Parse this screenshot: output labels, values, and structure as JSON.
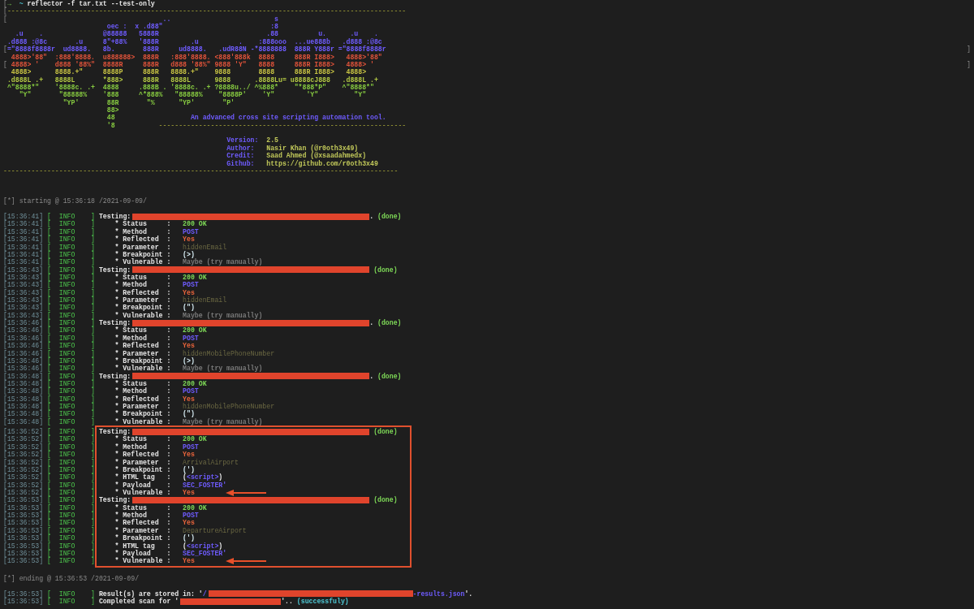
{
  "prompt": {
    "segments": [
      {
        "kind": "bracket",
        "text": "["
      },
      {
        "kind": "prompt",
        "text": "→"
      },
      {
        "kind": "dir",
        "text": "  ~"
      },
      {
        "kind": "command",
        "text": " reflector -f tar.txt --test-only"
      }
    ]
  },
  "banner": {
    "top_rule": {
      "segments": [
        {
          "kind": "bracket",
          "text": "["
        },
        {
          "kind": "rule",
          "text": "----------------------------------------------------------------------------------------------------"
        }
      ]
    },
    "art": [
      {
        "segments": [
          {
            "kind": "bracket",
            "text": "["
          },
          {
            "kind": "crest",
            "text": "                                       ..                          s"
          }
        ]
      },
      {
        "segments": [
          {
            "kind": "crest",
            "text": "                          oec :  x .d88\"                           :8"
          }
        ]
      },
      {
        "segments": [
          {
            "kind": "crest",
            "text": "   .u    .               @88888   5888R                           .88          u.      .u    ."
          }
        ]
      },
      {
        "segments": [
          {
            "kind": "crest",
            "text": " .d888 :@8c       .u     8\"+88%   '888R        .u          .    :888ooo  ...ue888b   .d888 :@8c"
          }
        ]
      },
      {
        "segments": [
          {
            "kind": "bracket",
            "text": "["
          },
          {
            "kind": "crest",
            "text": "=\"8888f8888r  ud8888.   8b.       888R     ud8888.   .udR88N -*8888888  888R Y888r =\"8888f8888r"
          }
        ],
        "edge": "]"
      },
      {
        "segments": [
          {
            "kind": "ember",
            "text": "  4888>'88\"  :888'8888.  u888888>  888R   :888'8888. <888'888k  8888     888R I888>   4888>'88\""
          }
        ]
      },
      {
        "segments": [
          {
            "kind": "bracket",
            "text": "["
          },
          {
            "kind": "ember",
            "text": " 4888> '    d888 '88%\"  8888R     888R   d888 '88%\" 9888 'Y\"   8888     888R I888>   4888> '"
          }
        ],
        "edge": "]"
      },
      {
        "segments": [
          {
            "kind": "straw",
            "text": "  4888>      8888.+\"     8888P     888R   8888.+\"    9888       8888     888R I888>   4888>"
          }
        ]
      },
      {
        "segments": [
          {
            "kind": "lime",
            "text": " .d888L .+   8888L       *888>     888R   8888L      9888      .8888Lu= u8888cJ888   .d888L .+"
          }
        ]
      },
      {
        "segments": [
          {
            "kind": "leaf",
            "text": " ^\"8888*\"    '8888c. .+  4888     .888B . '8888c. .+ ?8888u../ ^%888*    \"*888*P\"    ^\"8888*\""
          }
        ]
      },
      {
        "segments": [
          {
            "kind": "leaf",
            "text": "    \"Y\"       \"88888%    '888     ^*888%   \"88888%    \"8888P'    'Y\"        'Y\"         \"Y\""
          }
        ]
      },
      {
        "segments": [
          {
            "kind": "leaf",
            "text": "               \"YP'       88R       \"%      \"YP'       \"P'"
          }
        ]
      },
      {
        "segments": [
          {
            "kind": "leaf",
            "text": "                          88>"
          }
        ]
      },
      {
        "segments": [
          {
            "kind": "leaf",
            "text": "                          48"
          },
          {
            "kind": "tagline",
            "text": "                   An advanced cross site scripting automation tool."
          }
        ]
      },
      {
        "segments": [
          {
            "kind": "leaf",
            "text": "                          '8"
          },
          {
            "kind": "rule",
            "text": "           --------------------------------------------------------------"
          }
        ]
      }
    ],
    "credits": [
      {
        "segments": [
          {
            "kind": "label",
            "text": "                                                        Version:"
          },
          {
            "kind": "value",
            "text": "  2.5"
          }
        ]
      },
      {
        "segments": [
          {
            "kind": "label",
            "text": "                                                        Author:"
          },
          {
            "kind": "value",
            "text": "   Nasir Khan (@r0oth3x49)"
          }
        ]
      },
      {
        "segments": [
          {
            "kind": "label",
            "text": "                                                        Credit:"
          },
          {
            "kind": "value",
            "text": "   Saad Ahmed (@xsaadahmedx)"
          }
        ]
      },
      {
        "segments": [
          {
            "kind": "label",
            "text": "                                                        Github:"
          },
          {
            "kind": "value",
            "text": "   https://github.com/r0oth3x49"
          }
        ]
      }
    ],
    "bottom_rule": {
      "segments": [
        {
          "kind": "rule",
          "text": "---------------------------------------------------------------------------------------------------"
        }
      ]
    }
  },
  "log": {
    "start": "[*] starting @ 15:36:18 /2021-09-09/",
    "tests": [
      {
        "time": "[15:36:41]",
        "level": "[  INFO    ]",
        "label": "Testing:",
        "highlighted": false,
        "tail": [
          {
            "kind": "plain",
            "text": "."
          },
          {
            "kind": "done",
            "text": " (done)"
          }
        ],
        "fields": [
          {
            "time": "[15:36:41]",
            "level": "[  INFO    ]",
            "label": "* Status     :",
            "arrow": false,
            "parts": [
              {
                "kind": "ok",
                "text": "200 OK"
              }
            ]
          },
          {
            "time": "[15:36:41]",
            "level": "[  INFO    ]",
            "label": "* Method     :",
            "arrow": false,
            "parts": [
              {
                "kind": "method",
                "text": "POST"
              }
            ]
          },
          {
            "time": "[15:36:41]",
            "level": "[  INFO    ]",
            "label": "* Reflected  :",
            "arrow": false,
            "parts": [
              {
                "kind": "yes",
                "text": "Yes"
              }
            ]
          },
          {
            "time": "[15:36:41]",
            "level": "[  INFO    ]",
            "label": "* Parameter  :",
            "arrow": false,
            "parts": [
              {
                "kind": "param",
                "text": "hiddenEmail"
              }
            ]
          },
          {
            "time": "[15:36:41]",
            "level": "[  INFO    ]",
            "label": "* Breakpoint :",
            "arrow": false,
            "parts": [
              {
                "kind": "breakpoint",
                "text": "(>)"
              }
            ]
          },
          {
            "time": "[15:36:41]",
            "level": "[  INFO    ]",
            "label": "* Vulnerable :",
            "arrow": false,
            "parts": [
              {
                "kind": "maybe",
                "text": "Maybe (try manually)"
              }
            ]
          }
        ]
      },
      {
        "time": "[15:36:43]",
        "level": "[  INFO    ]",
        "label": "Testing:",
        "highlighted": false,
        "tail": [
          {
            "kind": "done",
            "text": " (done)"
          }
        ],
        "fields": [
          {
            "time": "[15:36:43]",
            "level": "[  INFO    ]",
            "label": "* Status     :",
            "arrow": false,
            "parts": [
              {
                "kind": "ok",
                "text": "200 OK"
              }
            ]
          },
          {
            "time": "[15:36:43]",
            "level": "[  INFO    ]",
            "label": "* Method     :",
            "arrow": false,
            "parts": [
              {
                "kind": "method",
                "text": "POST"
              }
            ]
          },
          {
            "time": "[15:36:43]",
            "level": "[  INFO    ]",
            "label": "* Reflected  :",
            "arrow": false,
            "parts": [
              {
                "kind": "yes",
                "text": "Yes"
              }
            ]
          },
          {
            "time": "[15:36:43]",
            "level": "[  INFO    ]",
            "label": "* Parameter  :",
            "arrow": false,
            "parts": [
              {
                "kind": "param",
                "text": "hiddenEmail"
              }
            ]
          },
          {
            "time": "[15:36:43]",
            "level": "[  INFO    ]",
            "label": "* Breakpoint :",
            "arrow": false,
            "parts": [
              {
                "kind": "breakpoint",
                "text": "(\")"
              }
            ]
          },
          {
            "time": "[15:36:43]",
            "level": "[  INFO    ]",
            "label": "* Vulnerable :",
            "arrow": false,
            "parts": [
              {
                "kind": "maybe",
                "text": "Maybe (try manually)"
              }
            ]
          }
        ]
      },
      {
        "time": "[15:36:46]",
        "level": "[  INFO    ]",
        "label": "Testing:",
        "highlighted": false,
        "tail": [
          {
            "kind": "plain",
            "text": "."
          },
          {
            "kind": "done",
            "text": " (done)"
          }
        ],
        "fields": [
          {
            "time": "[15:36:46]",
            "level": "[  INFO    ]",
            "label": "* Status     :",
            "arrow": false,
            "parts": [
              {
                "kind": "ok",
                "text": "200 OK"
              }
            ]
          },
          {
            "time": "[15:36:46]",
            "level": "[  INFO    ]",
            "label": "* Method     :",
            "arrow": false,
            "parts": [
              {
                "kind": "method",
                "text": "POST"
              }
            ]
          },
          {
            "time": "[15:36:46]",
            "level": "[  INFO    ]",
            "label": "* Reflected  :",
            "arrow": false,
            "parts": [
              {
                "kind": "yes",
                "text": "Yes"
              }
            ]
          },
          {
            "time": "[15:36:46]",
            "level": "[  INFO    ]",
            "label": "* Parameter  :",
            "arrow": false,
            "parts": [
              {
                "kind": "param",
                "text": "hiddenMobilePhoneNumber"
              }
            ]
          },
          {
            "time": "[15:36:46]",
            "level": "[  INFO    ]",
            "label": "* Breakpoint :",
            "arrow": false,
            "parts": [
              {
                "kind": "breakpoint",
                "text": "(>)"
              }
            ]
          },
          {
            "time": "[15:36:46]",
            "level": "[  INFO    ]",
            "label": "* Vulnerable :",
            "arrow": false,
            "parts": [
              {
                "kind": "maybe",
                "text": "Maybe (try manually)"
              }
            ]
          }
        ]
      },
      {
        "time": "[15:36:48]",
        "level": "[  INFO    ]",
        "label": "Testing:",
        "highlighted": false,
        "tail": [
          {
            "kind": "plain",
            "text": "."
          },
          {
            "kind": "done",
            "text": " (done)"
          }
        ],
        "fields": [
          {
            "time": "[15:36:48]",
            "level": "[  INFO    ]",
            "label": "* Status     :",
            "arrow": false,
            "parts": [
              {
                "kind": "ok",
                "text": "200 OK"
              }
            ]
          },
          {
            "time": "[15:36:48]",
            "level": "[  INFO    ]",
            "label": "* Method     :",
            "arrow": false,
            "parts": [
              {
                "kind": "method",
                "text": "POST"
              }
            ]
          },
          {
            "time": "[15:36:48]",
            "level": "[  INFO    ]",
            "label": "* Reflected  :",
            "arrow": false,
            "parts": [
              {
                "kind": "yes",
                "text": "Yes"
              }
            ]
          },
          {
            "time": "[15:36:48]",
            "level": "[  INFO    ]",
            "label": "* Parameter  :",
            "arrow": false,
            "parts": [
              {
                "kind": "param",
                "text": "hiddenMobilePhoneNumber"
              }
            ]
          },
          {
            "time": "[15:36:48]",
            "level": "[  INFO    ]",
            "label": "* Breakpoint :",
            "arrow": false,
            "parts": [
              {
                "kind": "breakpoint",
                "text": "(\")"
              }
            ]
          },
          {
            "time": "[15:36:48]",
            "level": "[  INFO    ]",
            "label": "* Vulnerable :",
            "arrow": false,
            "parts": [
              {
                "kind": "maybe",
                "text": "Maybe (try manually)"
              }
            ]
          }
        ]
      },
      {
        "time": "[15:36:52]",
        "level": "[  INFO    ]",
        "label": "Testing:",
        "highlighted": true,
        "tail": [
          {
            "kind": "done",
            "text": " (done)"
          }
        ],
        "fields": [
          {
            "time": "[15:36:52]",
            "level": "[  INFO    ]",
            "label": "* Status     :",
            "arrow": false,
            "parts": [
              {
                "kind": "ok",
                "text": "200 OK"
              }
            ]
          },
          {
            "time": "[15:36:52]",
            "level": "[  INFO    ]",
            "label": "* Method     :",
            "arrow": false,
            "parts": [
              {
                "kind": "method",
                "text": "POST"
              }
            ]
          },
          {
            "time": "[15:36:52]",
            "level": "[  INFO    ]",
            "label": "* Reflected  :",
            "arrow": false,
            "parts": [
              {
                "kind": "yes",
                "text": "Yes"
              }
            ]
          },
          {
            "time": "[15:36:52]",
            "level": "[  INFO    ]",
            "label": "* Parameter  :",
            "arrow": false,
            "parts": [
              {
                "kind": "param",
                "text": "ArrivalAirport"
              }
            ]
          },
          {
            "time": "[15:36:52]",
            "level": "[  INFO    ]",
            "label": "* Breakpoint :",
            "arrow": false,
            "parts": [
              {
                "kind": "breakpoint",
                "text": "(')"
              }
            ]
          },
          {
            "time": "[15:36:52]",
            "level": "[  INFO    ]",
            "label": "* HTML tag   :",
            "arrow": false,
            "parts": [
              {
                "kind": "plain",
                "text": "("
              },
              {
                "kind": "tag",
                "text": "<script>"
              },
              {
                "kind": "plain",
                "text": ")"
              }
            ]
          },
          {
            "time": "[15:36:52]",
            "level": "[  INFO    ]",
            "label": "* Payload    :",
            "arrow": false,
            "parts": [
              {
                "kind": "payload",
                "text": "SEC_FOSTER'"
              }
            ]
          },
          {
            "time": "[15:36:52]",
            "level": "[  INFO    ]",
            "label": "* Vulnerable :",
            "arrow": true,
            "parts": [
              {
                "kind": "yes",
                "text": "Yes"
              }
            ]
          }
        ]
      },
      {
        "time": "[15:36:53]",
        "level": "[  INFO    ]",
        "label": "Testing:",
        "highlighted": true,
        "tail": [
          {
            "kind": "done",
            "text": " (done)"
          }
        ],
        "fields": [
          {
            "time": "[15:36:53]",
            "level": "[  INFO    ]",
            "label": "* Status     :",
            "arrow": false,
            "parts": [
              {
                "kind": "ok",
                "text": "200 OK"
              }
            ]
          },
          {
            "time": "[15:36:53]",
            "level": "[  INFO    ]",
            "label": "* Method     :",
            "arrow": false,
            "parts": [
              {
                "kind": "method",
                "text": "POST"
              }
            ]
          },
          {
            "time": "[15:36:53]",
            "level": "[  INFO    ]",
            "label": "* Reflected  :",
            "arrow": false,
            "parts": [
              {
                "kind": "yes",
                "text": "Yes"
              }
            ]
          },
          {
            "time": "[15:36:53]",
            "level": "[  INFO    ]",
            "label": "* Parameter  :",
            "arrow": false,
            "parts": [
              {
                "kind": "param",
                "text": "DepartureAirport"
              }
            ]
          },
          {
            "time": "[15:36:53]",
            "level": "[  INFO    ]",
            "label": "* Breakpoint :",
            "arrow": false,
            "parts": [
              {
                "kind": "breakpoint",
                "text": "(')"
              }
            ]
          },
          {
            "time": "[15:36:53]",
            "level": "[  INFO    ]",
            "label": "* HTML tag   :",
            "arrow": false,
            "parts": [
              {
                "kind": "plain",
                "text": "("
              },
              {
                "kind": "tag",
                "text": "<script>"
              },
              {
                "kind": "plain",
                "text": ")"
              }
            ]
          },
          {
            "time": "[15:36:53]",
            "level": "[  INFO    ]",
            "label": "* Payload    :",
            "arrow": false,
            "parts": [
              {
                "kind": "payload",
                "text": "SEC_FOSTER'"
              }
            ]
          },
          {
            "time": "[15:36:53]",
            "level": "[  INFO    ]",
            "label": "* Vulnerable :",
            "arrow": true,
            "parts": [
              {
                "kind": "yes",
                "text": "Yes"
              }
            ]
          }
        ]
      }
    ],
    "end": "[*] ending @ 15:36:53 /2021-09-09/",
    "results": [
      {
        "time": "[15:36:53]",
        "level": "[  INFO    ]",
        "kind": "stored",
        "parts": [
          {
            "kind": "plain",
            "text": "Result(s) are stored in: '"
          },
          {
            "kind": "path",
            "text": "/"
          },
          {
            "kind": "redaction"
          },
          {
            "kind": "path",
            "text": "-results.json"
          },
          {
            "kind": "plain",
            "text": "'."
          }
        ]
      },
      {
        "time": "[15:36:53]",
        "level": "[  INFO    ]",
        "kind": "completed",
        "parts": [
          {
            "kind": "plain",
            "text": "Completed scan for '"
          },
          {
            "kind": "redaction"
          },
          {
            "kind": "plain",
            "text": "'.."
          },
          {
            "kind": "success",
            "text": " (successfuly)"
          }
        ]
      }
    ]
  }
}
